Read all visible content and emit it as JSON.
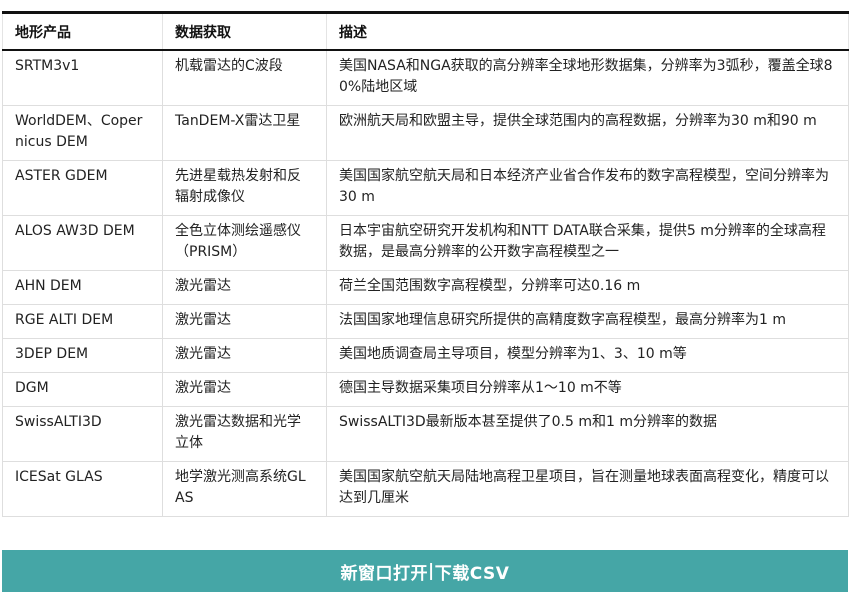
{
  "table": {
    "headers": [
      "地形产品",
      "数据获取",
      "描述"
    ],
    "rows": [
      [
        "SRTM3v1",
        "机载雷达的C波段",
        "美国NASA和NGA获取的高分辨率全球地形数据集，分辨率为3弧秒，覆盖全球80%陆地区域"
      ],
      [
        "WorldDEM、Copernicus DEM",
        "TanDEM-X雷达卫星",
        "欧洲航天局和欧盟主导，提供全球范围内的高程数据，分辨率为30 m和90 m"
      ],
      [
        "ASTER GDEM",
        "先进星载热发射和反辐射成像仪",
        "美国国家航空航天局和日本经济产业省合作发布的数字高程模型，空间分辨率为30 m"
      ],
      [
        "ALOS AW3D DEM",
        "全色立体测绘遥感仪（PRISM）",
        "日本宇宙航空研究开发机构和NTT DATA联合采集，提供5 m分辨率的全球高程数据，是最高分辨率的公开数字高程模型之一"
      ],
      [
        "AHN DEM",
        "激光雷达",
        "荷兰全国范围数字高程模型，分辨率可达0.16 m"
      ],
      [
        "RGE ALTI DEM",
        "激光雷达",
        "法国国家地理信息研究所提供的高精度数字高程模型，最高分辨率为1 m"
      ],
      [
        "3DEP DEM",
        "激光雷达",
        "美国地质调查局主导项目，模型分辨率为1、3、10 m等"
      ],
      [
        "DGM",
        "激光雷达",
        "德国主导数据采集项目分辨率从1～10 m不等"
      ],
      [
        "SwissALTI3D",
        "激光雷达数据和光学立体",
        "SwissALTI3D最新版本甚至提供了0.5 m和1 m分辨率的数据"
      ],
      [
        "ICESat GLAS",
        "地学激光测高系统GLAS",
        "美国国家航空航天局陆地高程卫星项目，旨在测量地球表面高程变化，精度可以达到几厘米"
      ]
    ]
  },
  "actions": {
    "open_new_window": "新窗口打开",
    "separator": "|",
    "download_csv": "下载CSV"
  }
}
